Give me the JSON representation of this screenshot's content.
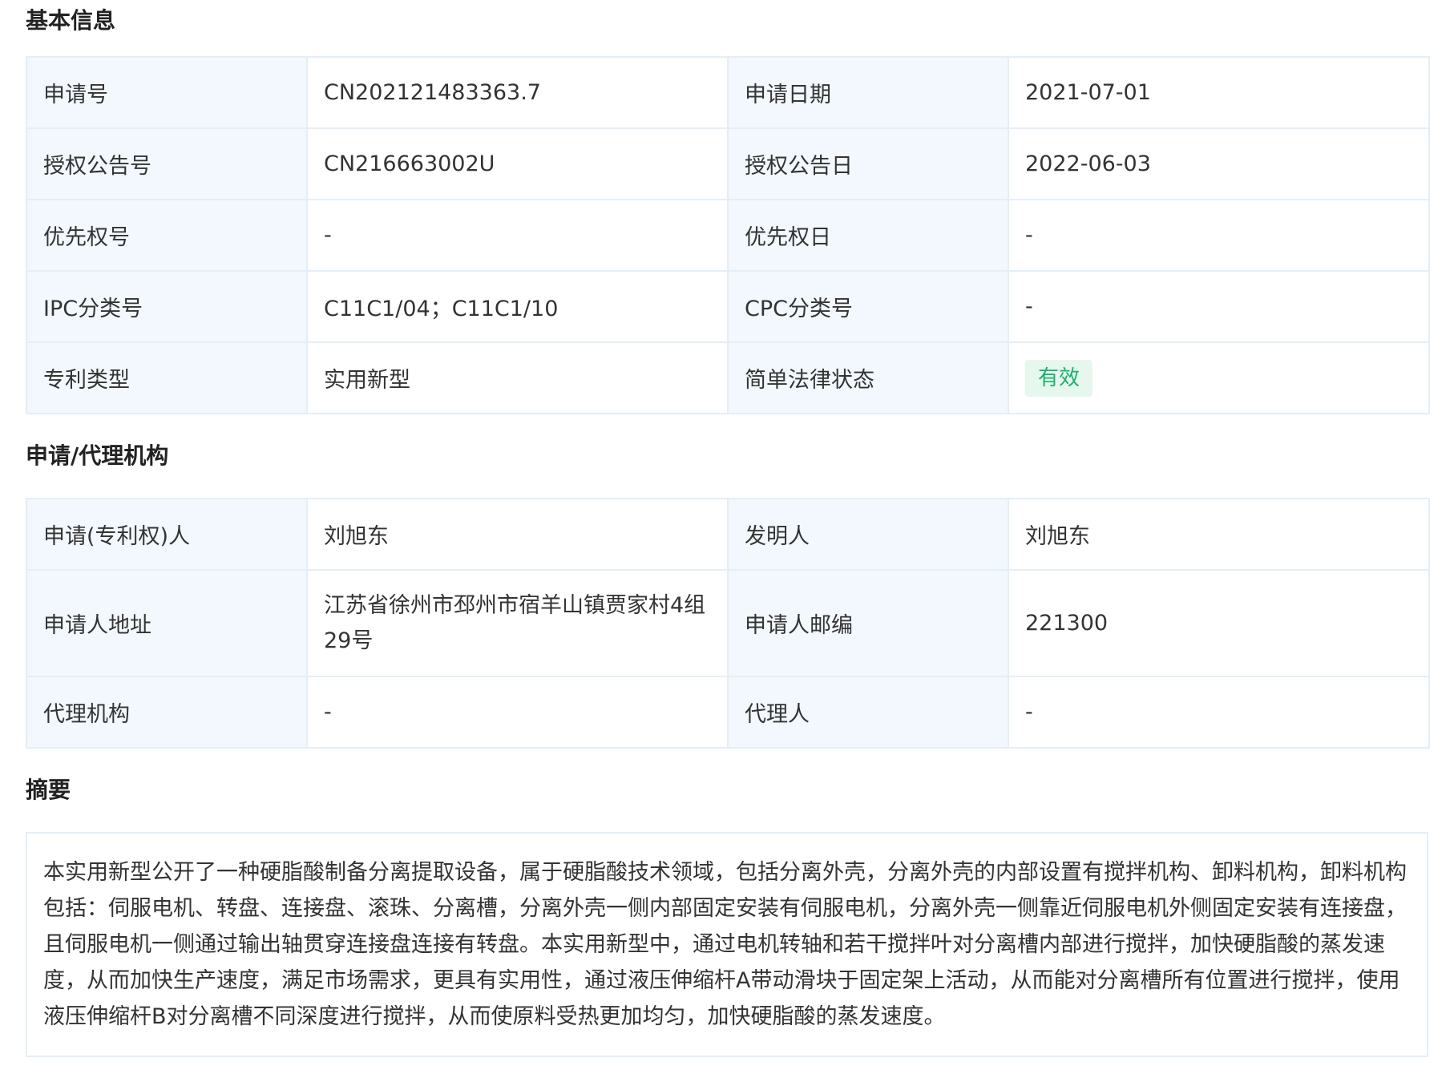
{
  "basic_info": {
    "title": "基本信息",
    "rows": [
      [
        {
          "label": "申请号",
          "value": "CN202121483363.7"
        },
        {
          "label": "申请日期",
          "value": "2021-07-01"
        }
      ],
      [
        {
          "label": "授权公告号",
          "value": "CN216663002U"
        },
        {
          "label": "授权公告日",
          "value": "2022-06-03"
        }
      ],
      [
        {
          "label": "优先权号",
          "value": "-"
        },
        {
          "label": "优先权日",
          "value": "-"
        }
      ],
      [
        {
          "label": "IPC分类号",
          "value": "C11C1/04；C11C1/10"
        },
        {
          "label": "CPC分类号",
          "value": "-"
        }
      ],
      [
        {
          "label": "专利类型",
          "value": "实用新型"
        },
        {
          "label": "简单法律状态",
          "value": "有效"
        }
      ]
    ]
  },
  "agency_info": {
    "title": "申请/代理机构",
    "rows": [
      [
        {
          "label": "申请(专利权)人",
          "value": "刘旭东"
        },
        {
          "label": "发明人",
          "value": "刘旭东"
        }
      ],
      [
        {
          "label": "申请人地址",
          "value": "江苏省徐州市邳州市宿羊山镇贾家村4组29号"
        },
        {
          "label": "申请人邮编",
          "value": "221300"
        }
      ],
      [
        {
          "label": "代理机构",
          "value": "-"
        },
        {
          "label": "代理人",
          "value": "-"
        }
      ]
    ]
  },
  "abstract": {
    "title": "摘要",
    "text": "本实用新型公开了一种硬脂酸制备分离提取设备，属于硬脂酸技术领域，包括分离外壳，分离外壳的内部设置有搅拌机构、卸料机构，卸料机构包括：伺服电机、转盘、连接盘、滚珠、分离槽，分离外壳一侧内部固定安装有伺服电机，分离外壳一侧靠近伺服电机外侧固定安装有连接盘，且伺服电机一侧通过输出轴贯穿连接盘连接有转盘。本实用新型中，通过电机转轴和若干搅拌叶对分离槽内部进行搅拌，加快硬脂酸的蒸发速度，从而加快生产速度，满足市场需求，更具有实用性，通过液压伸缩杆A带动滑块于固定架上活动，从而能对分离槽所有位置进行搅拌，使用液压伸缩杆B对分离槽不同深度进行搅拌，从而使原料受热更加均匀，加快硬脂酸的蒸发速度。"
  },
  "colors": {
    "label_bg": "#f2f8fd",
    "border": "#e3eef7",
    "badge_bg": "#e6f7ee",
    "badge_text": "#1bb26b"
  }
}
